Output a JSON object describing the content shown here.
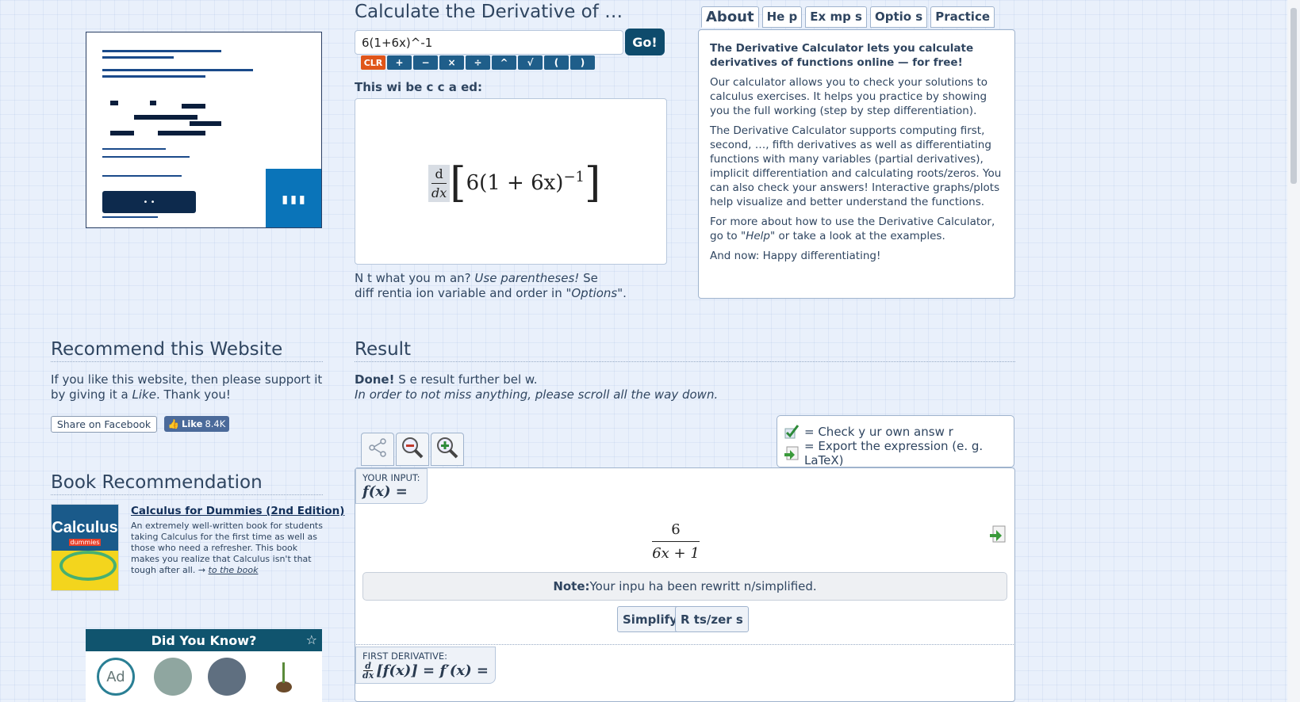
{
  "calculator": {
    "title": "Calculate the Derivative of …",
    "input_value": "6(1+6x)^-1",
    "go_label": "Go!",
    "keypad": [
      "CLR",
      "+",
      "−",
      "×",
      "÷",
      "^",
      "√",
      "(",
      ")"
    ],
    "subtitle": "This wi  be c  c  a ed:",
    "preview_numerator": "d",
    "preview_denominator": "dx",
    "preview_expression": "6(1 + 6x)",
    "preview_exponent": "−1",
    "note_line1_start": "N  t what you m  an? ",
    "note_line1_em": "Use parentheses!",
    "note_line1_end": " Se",
    "note_line2_start": "diff  rentia ion variable and order in \"",
    "note_line2_em": "Options",
    "note_line2_end": "\"."
  },
  "tabs": [
    "About",
    "He p",
    "Ex  mp    s",
    "Optio  s",
    "Practice"
  ],
  "about": {
    "intro_bold": "The Derivative Calculator lets you calculate derivatives of functions online — for free!",
    "p1": "Our calculator allows you to check your solutions to calculus exercises. It helps you practice by showing you the full working (step by step differentiation).",
    "p2": "The Derivative Calculator supports computing first, second, …, fifth derivatives as well as differentiating functions with many variables (partial derivatives), implicit differentiation and calculating roots/zeros. You can also check your answers! Interactive graphs/plots help visualize and better understand the functions.",
    "p3_start": "For more about how to use the Derivative Calculator, go to \"",
    "p3_em": "Help",
    "p3_end": "\" or take a look at the examples.",
    "p4": "And now: Happy differentiating!"
  },
  "recommend": {
    "heading": "Recommend this Website",
    "text_start": "If you like this website, then please support it by giving it a ",
    "text_em": "Like",
    "text_end": ". Thank you!",
    "share_label": "Share on Facebook",
    "like_label": "Like",
    "like_count": "8.4K"
  },
  "book": {
    "heading": "Book Recommendation",
    "cover_title": "Calculus",
    "cover_sub": "dummies",
    "title": "Calculus for Dummies (2nd Edition)",
    "description": "An extremely well-written book for students taking Calculus for the first time as well as those who need a refresher. This book makes you realize that Calculus isn't that tough after all. → ",
    "link": "to the book"
  },
  "did_you_know": {
    "title": "Did You Know?",
    "ad_label": "Ad"
  },
  "result": {
    "heading": "Result",
    "done_bold": "Done!",
    "done_rest": " S  e       result further bel  w.",
    "scroll_note": "In order to not miss anything, please scroll all the way down.",
    "legend_check": "= Check y  ur own answ  r",
    "legend_export": "= Export the expression (e. g. LaTeX)",
    "your_input_label": "YOUR INPUT:",
    "your_input_math": "f(x) =",
    "fraction_num": "6",
    "fraction_den": "6x + 1",
    "note_bold": "Note:",
    "note_rest": " Your inpu   ha   been rewritt  n/simplified.",
    "simplify_label": "Simplify",
    "roots_label": "R     ts/zer  s",
    "first_derivative_label": "FIRST DERIVATIVE:",
    "first_derivative_math": "[f(x)] = f′(x) ="
  },
  "colors": {
    "background": "#e9f0fb",
    "go_button": "#0e4b6c",
    "keypad": "#1f5e8a",
    "clr_key": "#e0561a",
    "dyk_header": "#10546e"
  },
  "icons": [
    "share-icon",
    "zoom-out-icon",
    "zoom-in-icon",
    "check-answer-icon",
    "export-icon",
    "pin-star-icon"
  ]
}
